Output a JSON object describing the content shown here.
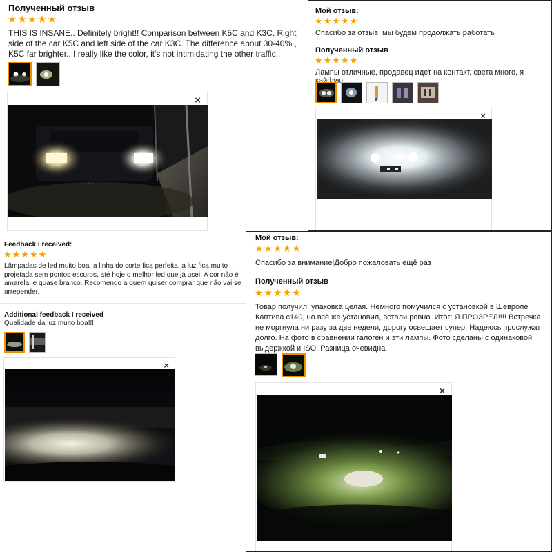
{
  "panel_a": {
    "heading": "Полученный отзыв",
    "stars": "★★★★★",
    "text": "THIS IS INSANE.. Definitely bright!! Comparison between K5C and K3C. Right side of the car K5C and left side of the car K3C. The difference about 30-40% , K5C far brighter.. I really like the color, it's not intimidating the other traffic..",
    "close": "×"
  },
  "panel_b": {
    "my_heading": "Мой отзыв:",
    "my_stars": "★★★★★",
    "my_text": "Спасибо за отзыв, мы будем продолжать работать",
    "recv_heading": "Полученный отзыв",
    "recv_stars": "★★★★★",
    "recv_text": "Лампы отличные, продавец идет на контакт, света много, я кайфую",
    "close": "×"
  },
  "panel_c": {
    "heading": "Feedback I received:",
    "stars": "★★★★★",
    "text": "Lâmpadas de led muito boa, a linha do corte fica perfeita, a luz fica muito projetada sem pontos escuros, até hoje o melhor led que já usei. A cor não é amarela, e quase branco. Recomendo a quem quiser comprar que não vai se arrepender.",
    "additional_heading": "Additional feedback I received",
    "additional_text": "Qualidade da luz muito boa!!!!",
    "close": "×"
  },
  "panel_d": {
    "my_heading": "Мой отзыв:",
    "my_stars": "★★★★★",
    "my_text": "Спасибо за внимание!Добро пожаловать ещё раз",
    "recv_heading": "Полученный отзыв",
    "recv_stars": "★★★★★",
    "recv_text": "Товар получил, упаковка целая. Немного помучился с установкой в Шевроле Каптива с140, но всё же установил, встали ровно. Итог: Я ПРОЗРЕЛ!!!! Встречка не моргнула ни разу за две недели, дорогу освещает супер. Надеюсь прослужат долго. На фото в сравнении галоген и эти лампы. Фото сделаны с одинаковой выдержкой и ISO. Разница очевидна.",
    "close": "×"
  },
  "colors": {
    "star": "#f5a200",
    "selected_thumb": "#f09000",
    "border": "#222222"
  }
}
